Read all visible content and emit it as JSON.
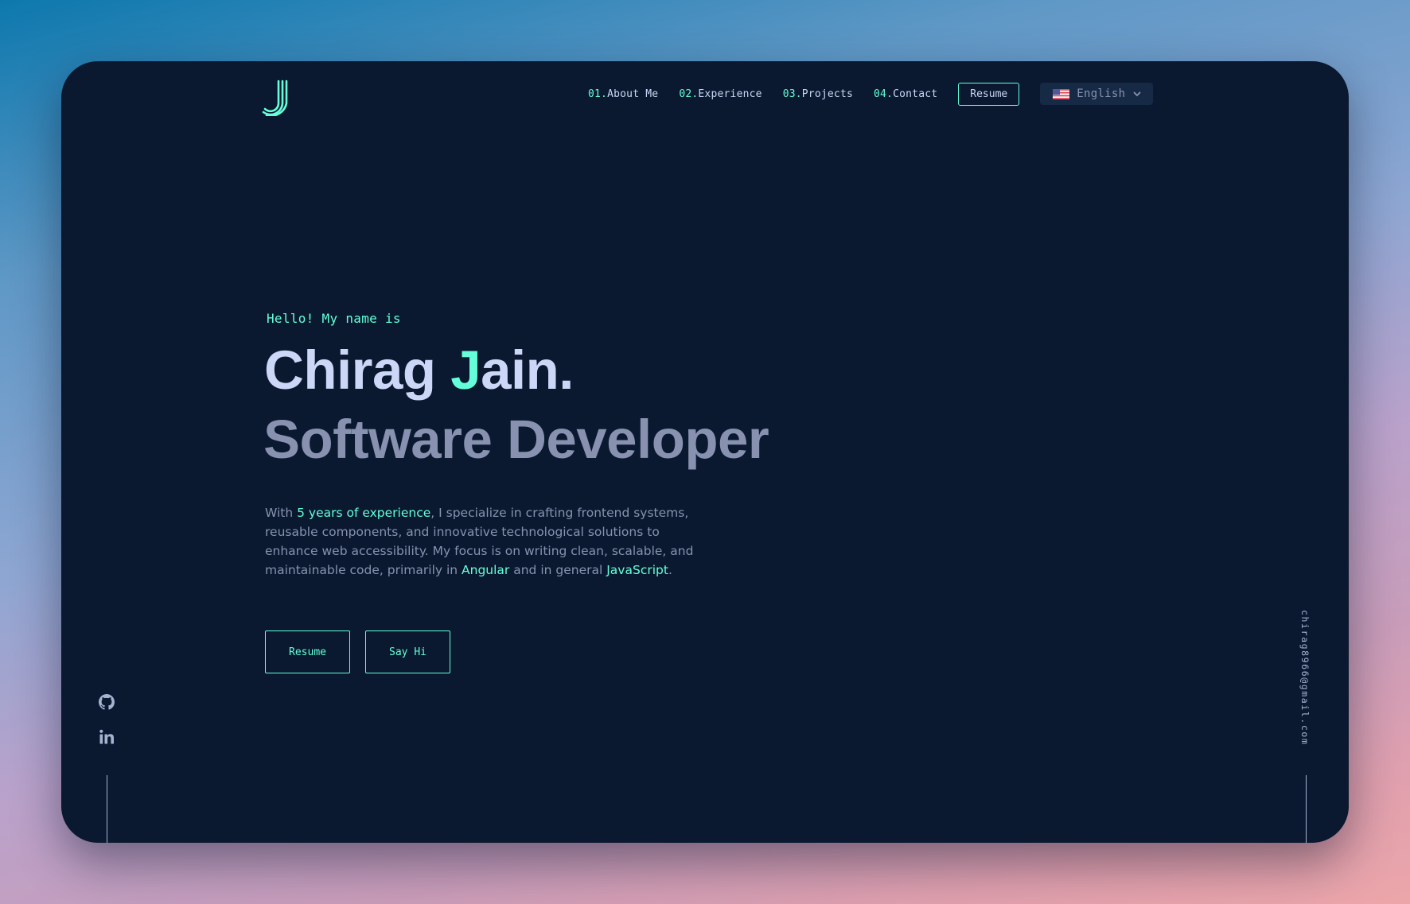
{
  "nav": {
    "items": [
      {
        "num": "01.",
        "label": "About Me"
      },
      {
        "num": "02.",
        "label": "Experience"
      },
      {
        "num": "03.",
        "label": "Projects"
      },
      {
        "num": "04.",
        "label": "Contact"
      }
    ],
    "resume_label": "Resume",
    "language": {
      "selected": "English",
      "flag_icon": "us-flag-icon"
    }
  },
  "hero": {
    "greeting": "Hello! My name is",
    "name_first": "Chirag ",
    "name_initial": "J",
    "name_rest": "ain.",
    "role": "Software Developer",
    "bio": {
      "part1": "With ",
      "highlight1": "5 years of experience",
      "part2": ", I specialize in crafting frontend systems, reusable components, and innovative technological solutions to enhance web accessibility. My focus is on writing clean, scalable, and maintainable code, primarily in ",
      "highlight2": "Angular",
      "part3": " and in general ",
      "highlight3": "JavaScript",
      "part4": "."
    },
    "buttons": {
      "resume": "Resume",
      "say_hi": "Say Hi"
    }
  },
  "social": {
    "icons": [
      "github-icon",
      "linkedin-icon"
    ]
  },
  "email": "chirag8966@gmail.com",
  "colors": {
    "background": "#0a192f",
    "accent": "#64ffda",
    "heading": "#ccd6f6",
    "muted": "#8892b0",
    "dropdown_bg": "#172a45"
  }
}
